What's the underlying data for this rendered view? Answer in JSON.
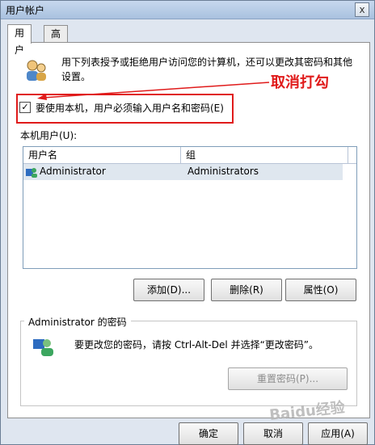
{
  "window": {
    "title": "用户帐户",
    "close_glyph": "x"
  },
  "tabs": [
    {
      "label": "用户",
      "active": true
    },
    {
      "label": "高级",
      "active": false
    }
  ],
  "intro": {
    "text": "用下列表授予或拒绝用户访问您的计算机，还可以更改其密码和其他设置。"
  },
  "checkbox": {
    "checked": true,
    "glyph": "✓",
    "label": "要使用本机，用户必须输入用户名和密码(E)"
  },
  "annotation": {
    "text": "取消打勾",
    "color": "#e01b1b"
  },
  "users_section": {
    "label": "本机用户(U):",
    "columns": [
      "用户名",
      "组"
    ],
    "rows": [
      {
        "user": "Administrator",
        "group": "Administrators"
      }
    ]
  },
  "buttons": {
    "add": "添加(D)...",
    "remove": "删除(R)",
    "properties": "属性(O)",
    "reset_password": "重置密码(P)...",
    "ok": "确定",
    "cancel": "取消",
    "apply": "应用(A)"
  },
  "password_group": {
    "title": "Administrator 的密码",
    "text": "要更改您的密码，请按 Ctrl-Alt-Del 并选择“更改密码”。"
  },
  "watermark": {
    "text": "Baidu经验"
  },
  "colors": {
    "accent": "#e01b1b",
    "selection": "#dfe7ef",
    "titlebar": "#b9cde6"
  },
  "icons": {
    "users": "users-icon",
    "admin": "admin-user-icon",
    "row_user": "user-small-icon"
  }
}
